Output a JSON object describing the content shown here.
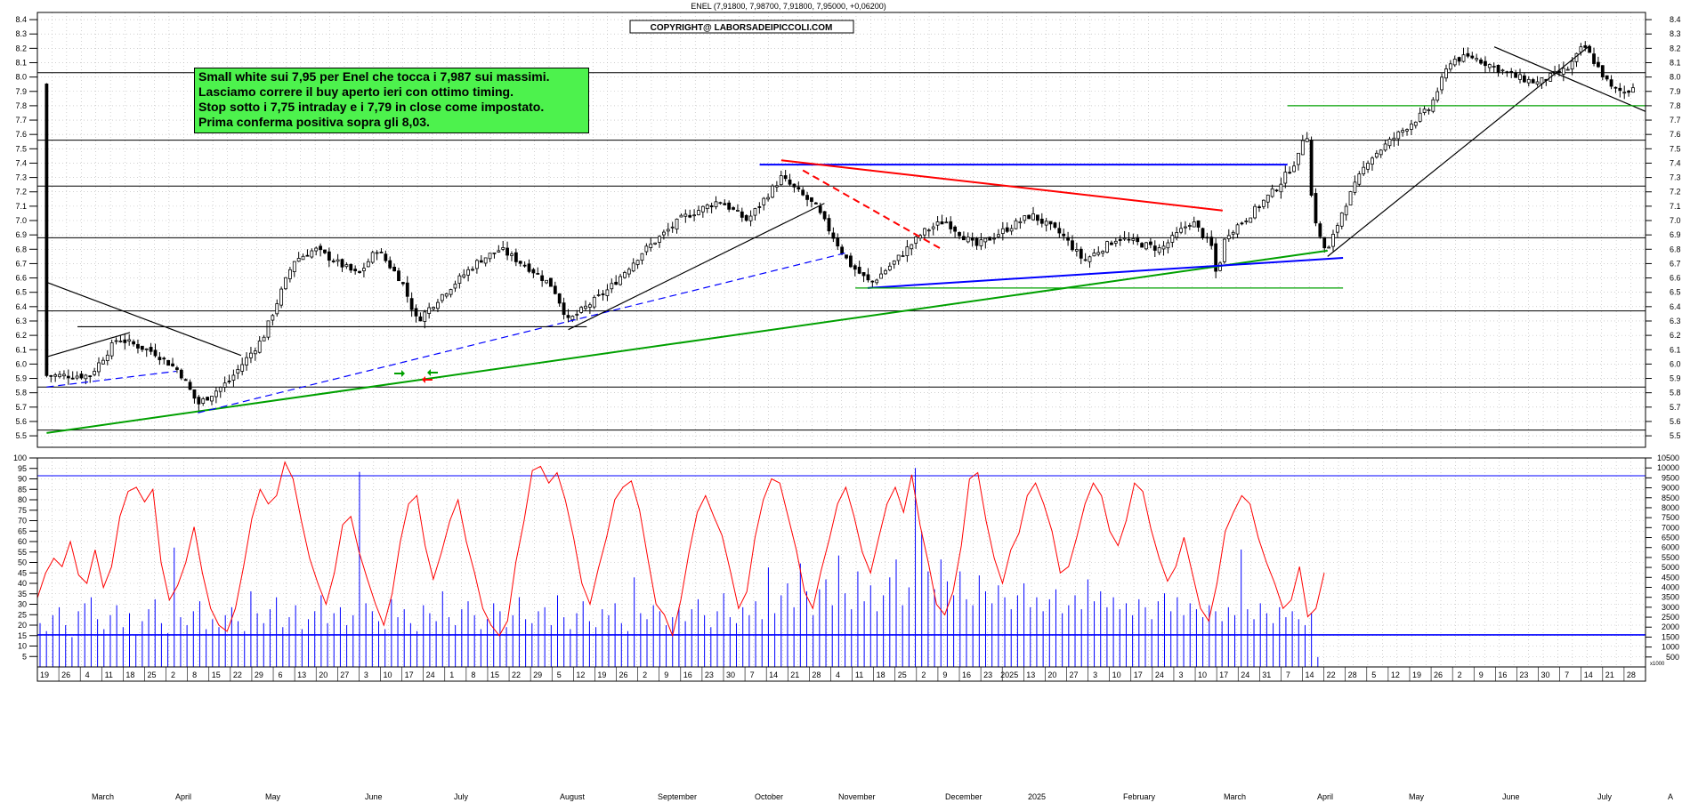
{
  "header": {
    "ohlc_caption": "ENEL (7,91800, 7,98700, 7,91800, 7,95000, +0,06200)",
    "copyright": "COPYRIGHT@ LABORSADEIPICCOLI.COM"
  },
  "note": {
    "lines": [
      "Small white sui 7,95 per Enel che tocca i 7,987 sui massimi.",
      "Lasciamo correre il buy aperto ieri con ottimo timing.",
      "Stop sotto i 7,75 intraday e i 7,79 in close come impostato.",
      "Prima conferma positiva sopra gli 8,03."
    ]
  },
  "colors": {
    "price_bars": "#000000",
    "grid": "#b4b4b4",
    "support_green": "#00a000",
    "trend_blue": "#0000ff",
    "resistance_red": "#ff0000",
    "oscillator": "#ff0000",
    "volume": "#0000ff",
    "note_background": "#4df24d"
  },
  "chart_data": [
    {
      "type": "candlestick",
      "ylim": [
        5.42,
        8.45
      ],
      "y_ticks": [
        "8.4",
        "8.3",
        "8.2",
        "8.1",
        "8.0",
        "7.9",
        "7.8",
        "7.7",
        "7.6",
        "7.5",
        "7.4",
        "7.3",
        "7.2",
        "7.1",
        "7.0",
        "6.9",
        "6.8",
        "6.7",
        "6.6",
        "6.5",
        "6.4",
        "6.3",
        "6.2",
        "6.1",
        "6.0",
        "5.9",
        "5.8",
        "5.7",
        "5.6",
        "5.5"
      ],
      "grid": true,
      "horizontal_levels": [
        8.03,
        7.56,
        7.24,
        6.88,
        6.37,
        5.84,
        5.54
      ],
      "green_levels": [
        7.8,
        6.53
      ],
      "x_day_ticks": [
        "19",
        "26",
        "4",
        "11",
        "18",
        "25",
        "2",
        "8",
        "15",
        "22",
        "29",
        "6",
        "13",
        "20",
        "27",
        "3",
        "10",
        "17",
        "24",
        "1",
        "8",
        "15",
        "22",
        "29",
        "5",
        "12",
        "19",
        "26",
        "2",
        "9",
        "16",
        "23",
        "30",
        "7",
        "14",
        "21",
        "28",
        "4",
        "11",
        "18",
        "25",
        "2",
        "9",
        "16",
        "23",
        "2025",
        "13",
        "20",
        "27",
        "3",
        "10",
        "17",
        "24",
        "3",
        "10",
        "17",
        "24",
        "31",
        "7",
        "14",
        "22",
        "28",
        "5",
        "12",
        "19",
        "26",
        "2",
        "9",
        "16",
        "23",
        "30",
        "7",
        "14",
        "21",
        "28"
      ],
      "x_month_labels": [
        "March",
        "April",
        "May",
        "June",
        "July",
        "August",
        "September",
        "October",
        "November",
        "December",
        "2025",
        "February",
        "March",
        "April",
        "May",
        "June",
        "July",
        "A"
      ],
      "close_path": [
        [
          "2024-02-19",
          5.92
        ],
        [
          "2024-03-04",
          5.92
        ],
        [
          "2024-03-13",
          6.18
        ],
        [
          "2024-03-25",
          6.08
        ],
        [
          "2024-04-02",
          5.95
        ],
        [
          "2024-04-08",
          5.72
        ],
        [
          "2024-04-18",
          5.88
        ],
        [
          "2024-04-29",
          6.18
        ],
        [
          "2024-05-09",
          6.72
        ],
        [
          "2024-05-16",
          6.8
        ],
        [
          "2024-05-30",
          6.62
        ],
        [
          "2024-06-05",
          6.8
        ],
        [
          "2024-06-13",
          6.58
        ],
        [
          "2024-06-18",
          6.3
        ],
        [
          "2024-06-26",
          6.48
        ],
        [
          "2024-07-08",
          6.72
        ],
        [
          "2024-07-15",
          6.8
        ],
        [
          "2024-07-25",
          6.66
        ],
        [
          "2024-08-01",
          6.54
        ],
        [
          "2024-08-06",
          6.3
        ],
        [
          "2024-08-19",
          6.52
        ],
        [
          "2024-08-30",
          6.78
        ],
        [
          "2024-09-12",
          7.02
        ],
        [
          "2024-09-24",
          7.14
        ],
        [
          "2024-10-03",
          7.0
        ],
        [
          "2024-10-14",
          7.3
        ],
        [
          "2024-10-25",
          7.1
        ],
        [
          "2024-11-05",
          6.7
        ],
        [
          "2024-11-12",
          6.56
        ],
        [
          "2024-11-20",
          6.72
        ],
        [
          "2024-11-29",
          6.92
        ],
        [
          "2024-12-06",
          7.0
        ],
        [
          "2024-12-16",
          6.82
        ],
        [
          "2025-01-03",
          7.04
        ],
        [
          "2025-01-13",
          6.9
        ],
        [
          "2025-01-20",
          6.72
        ],
        [
          "2025-01-31",
          6.88
        ],
        [
          "2025-02-14",
          6.8
        ],
        [
          "2025-02-24",
          7.0
        ],
        [
          "2025-03-03",
          6.8
        ],
        [
          "2025-03-04",
          6.6
        ],
        [
          "2025-03-07",
          6.9
        ],
        [
          "2025-03-14",
          7.02
        ],
        [
          "2025-03-24",
          7.24
        ],
        [
          "2025-03-31",
          7.46
        ],
        [
          "2025-04-02",
          7.7
        ],
        [
          "2025-04-04",
          7.1
        ],
        [
          "2025-04-07",
          6.84
        ],
        [
          "2025-04-09",
          6.78
        ],
        [
          "2025-04-14",
          7.08
        ],
        [
          "2025-04-22",
          7.42
        ],
        [
          "2025-05-05",
          7.66
        ],
        [
          "2025-05-12",
          7.78
        ],
        [
          "2025-05-19",
          8.12
        ],
        [
          "2025-05-26",
          8.14
        ],
        [
          "2025-06-09",
          8.0
        ],
        [
          "2025-06-16",
          7.96
        ],
        [
          "2025-06-26",
          8.06
        ],
        [
          "2025-07-01",
          8.22
        ],
        [
          "2025-07-04",
          8.12
        ],
        [
          "2025-07-10",
          7.92
        ],
        [
          "2025-07-15",
          7.89
        ],
        [
          "2025-07-17",
          7.95
        ]
      ],
      "trendlines": [
        {
          "color": "green",
          "style": "solid",
          "from": [
            "2024-02-19",
            5.52
          ],
          "to": [
            "2025-04-09",
            6.79
          ]
        },
        {
          "color": "blue",
          "style": "solid",
          "from": [
            "2024-10-07",
            7.39
          ],
          "to": [
            "2025-03-27",
            7.39
          ]
        },
        {
          "color": "red",
          "style": "solid",
          "from": [
            "2024-10-14",
            7.42
          ],
          "to": [
            "2025-03-06",
            7.07
          ]
        },
        {
          "color": "red",
          "style": "dashed",
          "from": [
            "2024-10-21",
            7.35
          ],
          "to": [
            "2024-12-05",
            6.8
          ]
        },
        {
          "color": "blue",
          "style": "solid",
          "from": [
            "2024-11-11",
            6.53
          ],
          "to": [
            "2025-04-14",
            6.74
          ]
        },
        {
          "color": "blue",
          "style": "dashed",
          "from": [
            "2024-04-08",
            5.66
          ],
          "to": [
            "2024-11-05",
            6.78
          ]
        },
        {
          "color": "blue",
          "style": "dashed",
          "from": [
            "2024-02-19",
            5.84
          ],
          "to": [
            "2024-04-01",
            5.95
          ]
        },
        {
          "color": "black",
          "style": "solid",
          "from": [
            "2024-08-06",
            6.24
          ],
          "to": [
            "2024-10-28",
            7.12
          ]
        },
        {
          "color": "black",
          "style": "solid",
          "from": [
            "2024-02-19",
            6.57
          ],
          "to": [
            "2024-04-22",
            6.06
          ]
        },
        {
          "color": "black",
          "style": "solid",
          "from": [
            "2024-02-19",
            6.05
          ],
          "to": [
            "2024-03-17",
            6.22
          ]
        },
        {
          "color": "black",
          "style": "solid",
          "from": [
            "2025-04-09",
            6.75
          ],
          "to": [
            "2025-07-03",
            8.22
          ]
        },
        {
          "color": "black",
          "style": "solid",
          "from": [
            "2025-06-02",
            8.21
          ],
          "to": [
            "2025-07-21",
            7.76
          ]
        },
        {
          "color": "black",
          "style": "solid",
          "from": [
            "2024-02-29",
            6.26
          ],
          "to": [
            "2024-08-12",
            6.26
          ]
        },
        {
          "color": "green",
          "style": "solid",
          "from": [
            "2024-11-07",
            6.53
          ],
          "to": [
            "2025-04-14",
            6.53
          ]
        },
        {
          "color": "green",
          "style": "solid",
          "from": [
            "2025-03-27",
            7.8
          ],
          "to": [
            "2025-07-21",
            7.8
          ]
        }
      ],
      "last_bar": {
        "open": 7.918,
        "high": 7.987,
        "low": 7.918,
        "close": 7.95,
        "change": 0.062
      }
    },
    {
      "type": "line",
      "name": "",
      "ylim": [
        0,
        100
      ],
      "y_ticks": [
        "100",
        "95",
        "90",
        "85",
        "80",
        "75",
        "70",
        "65",
        "60",
        "55",
        "50",
        "45",
        "40",
        "35",
        "30",
        "25",
        "20",
        "15",
        "10",
        "5"
      ],
      "levels": [
        91.5,
        15.5
      ],
      "values": [
        33,
        45,
        52,
        48,
        60,
        44,
        40,
        56,
        38,
        48,
        72,
        84,
        86,
        79,
        85,
        50,
        32,
        39,
        50,
        67,
        45,
        28,
        20,
        17,
        28,
        48,
        71,
        85,
        78,
        82,
        98,
        90,
        70,
        52,
        40,
        30,
        45,
        68,
        72,
        55,
        42,
        30,
        20,
        35,
        60,
        78,
        82,
        58,
        42,
        55,
        70,
        80,
        60,
        45,
        28,
        20,
        15,
        22,
        50,
        70,
        94,
        96,
        88,
        93,
        80,
        62,
        40,
        30,
        47,
        62,
        80,
        86,
        89,
        75,
        52,
        30,
        25,
        15,
        32,
        55,
        74,
        82,
        72,
        63,
        46,
        28,
        36,
        62,
        80,
        90,
        88,
        72,
        56,
        36,
        28,
        46,
        61,
        78,
        86,
        72,
        55,
        45,
        62,
        78,
        86,
        74,
        92,
        68,
        50,
        30,
        25,
        36,
        58,
        90,
        93,
        70,
        52,
        40,
        56,
        64,
        82,
        88,
        78,
        65,
        45,
        48,
        62,
        78,
        88,
        82,
        65,
        58,
        70,
        88,
        84,
        66,
        52,
        41,
        48,
        62,
        45,
        28,
        22,
        40,
        65,
        74,
        82,
        78,
        62,
        50,
        40,
        28,
        32,
        48,
        24,
        28,
        45
      ]
    },
    {
      "type": "bar",
      "name": "",
      "ylim": [
        0,
        10500
      ],
      "y_ticks": [
        "10500",
        "10000",
        "9500",
        "9000",
        "8500",
        "8000",
        "7500",
        "7000",
        "6500",
        "6000",
        "5500",
        "5000",
        "4500",
        "4000",
        "3500",
        "3000",
        "2500",
        "2000",
        "1500",
        "1000",
        "500"
      ],
      "axis_unit_label": "x1000",
      "levels": [
        1600
      ],
      "values": [
        2200,
        1800,
        2600,
        3000,
        2100,
        1500,
        2800,
        3200,
        3500,
        2400,
        1900,
        2600,
        3100,
        2000,
        2700,
        1600,
        2300,
        2900,
        3400,
        2200,
        1700,
        6000,
        2500,
        2100,
        2800,
        3300,
        1900,
        2400,
        2000,
        2600,
        3000,
        2300,
        1800,
        3800,
        2700,
        2200,
        2900,
        3500,
        2000,
        2500,
        3100,
        1900,
        2400,
        2800,
        3600,
        2200,
        2700,
        3000,
        2100,
        2600,
        9800,
        3200,
        2800,
        2300,
        1900,
        3400,
        2500,
        2900,
        2200,
        1800,
        3100,
        2700,
        2300,
        3800,
        2500,
        2100,
        2900,
        3300,
        2600,
        1900,
        2400,
        3200,
        2800,
        2000,
        2600,
        3500,
        2400,
        2200,
        2800,
        3000,
        2100,
        3600,
        2500,
        1900,
        2700,
        3300,
        2300,
        2000,
        2900,
        2600,
        3200,
        2200,
        1800,
        4500,
        2700,
        2400,
        3100,
        2800,
        2100,
        2500,
        3000,
        2300,
        2900,
        3400,
        2600,
        2000,
        2800,
        3700,
        2500,
        2200,
        3000,
        2600,
        3300,
        2400,
        5000,
        2700,
        3600,
        4200,
        3000,
        5200,
        3800,
        2600,
        3900,
        4400,
        3100,
        5600,
        3700,
        2900,
        4800,
        3300,
        4100,
        2800,
        3600,
        4500,
        5400,
        3100,
        4000,
        10000,
        6800,
        4800,
        3900,
        5400,
        4300,
        3600,
        4800,
        3400,
        3100,
        4600,
        3800,
        3200,
        4100,
        3500,
        2900,
        3600,
        4200,
        3000,
        3500,
        2800,
        3400,
        3900,
        2700,
        3100,
        3600,
        2900,
        4400,
        3300,
        3800,
        3000,
        3500,
        2900,
        3200,
        2600,
        3400,
        3000,
        2400,
        3300,
        3700,
        2800,
        3500,
        2600,
        3200,
        2900,
        2500,
        3100,
        2800,
        2300,
        3000,
        2600,
        5900,
        2900,
        2400,
        3200,
        2700,
        2200,
        3000,
        2500,
        2800,
        2400,
        2100,
        2700,
        500
      ]
    }
  ]
}
